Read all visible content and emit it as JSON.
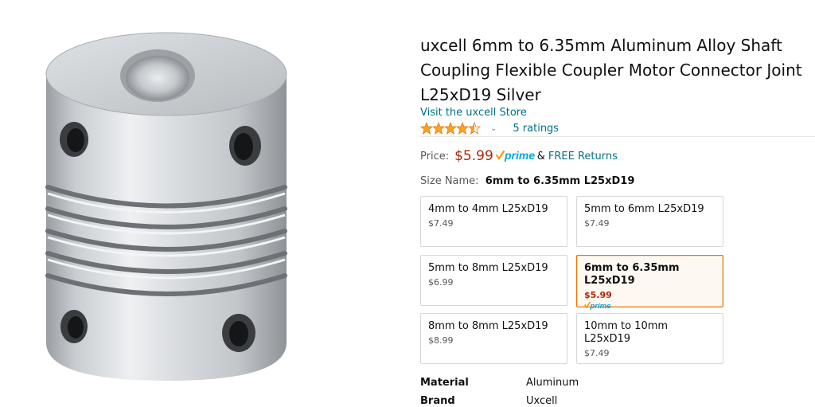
{
  "product": {
    "title": "uxcell 6mm to 6.35mm Aluminum Alloy Shaft Coupling Flexible Coupler Motor Connector Joint L25xD19 Silver",
    "store_link": "Visit the uxcell Store",
    "rating_stars": 4.5,
    "ratings_count": "5 ratings",
    "image_icon": "shaft-coupler-image"
  },
  "price": {
    "label": "Price:",
    "value": "$5.99",
    "prime_word": "prime",
    "amp": "&",
    "returns": "FREE Returns"
  },
  "size": {
    "label": "Size Name:",
    "selected": "6mm to 6.35mm L25xD19",
    "options": [
      {
        "name": "4mm to 4mm L25xD19",
        "price": "$7.49"
      },
      {
        "name": "5mm to 6mm L25xD19",
        "price": "$7.49"
      },
      {
        "name": "5mm to 8mm L25xD19",
        "price": "$6.99"
      },
      {
        "name": "6mm to 6.35mm L25xD19",
        "price": "$5.99",
        "prime": "prime"
      },
      {
        "name": "8mm to 8mm L25xD19",
        "price": "$8.99"
      },
      {
        "name": "10mm to 10mm L25xD19",
        "price": "$7.49"
      }
    ]
  },
  "specs": [
    {
      "key": "Material",
      "value": "Aluminum"
    },
    {
      "key": "Brand",
      "value": "Uxcell"
    }
  ],
  "colors": {
    "link": "#007185",
    "price": "#B12704",
    "star": "#FFA41C",
    "prime": "#00A8E1",
    "selected_border": "#e77600"
  }
}
